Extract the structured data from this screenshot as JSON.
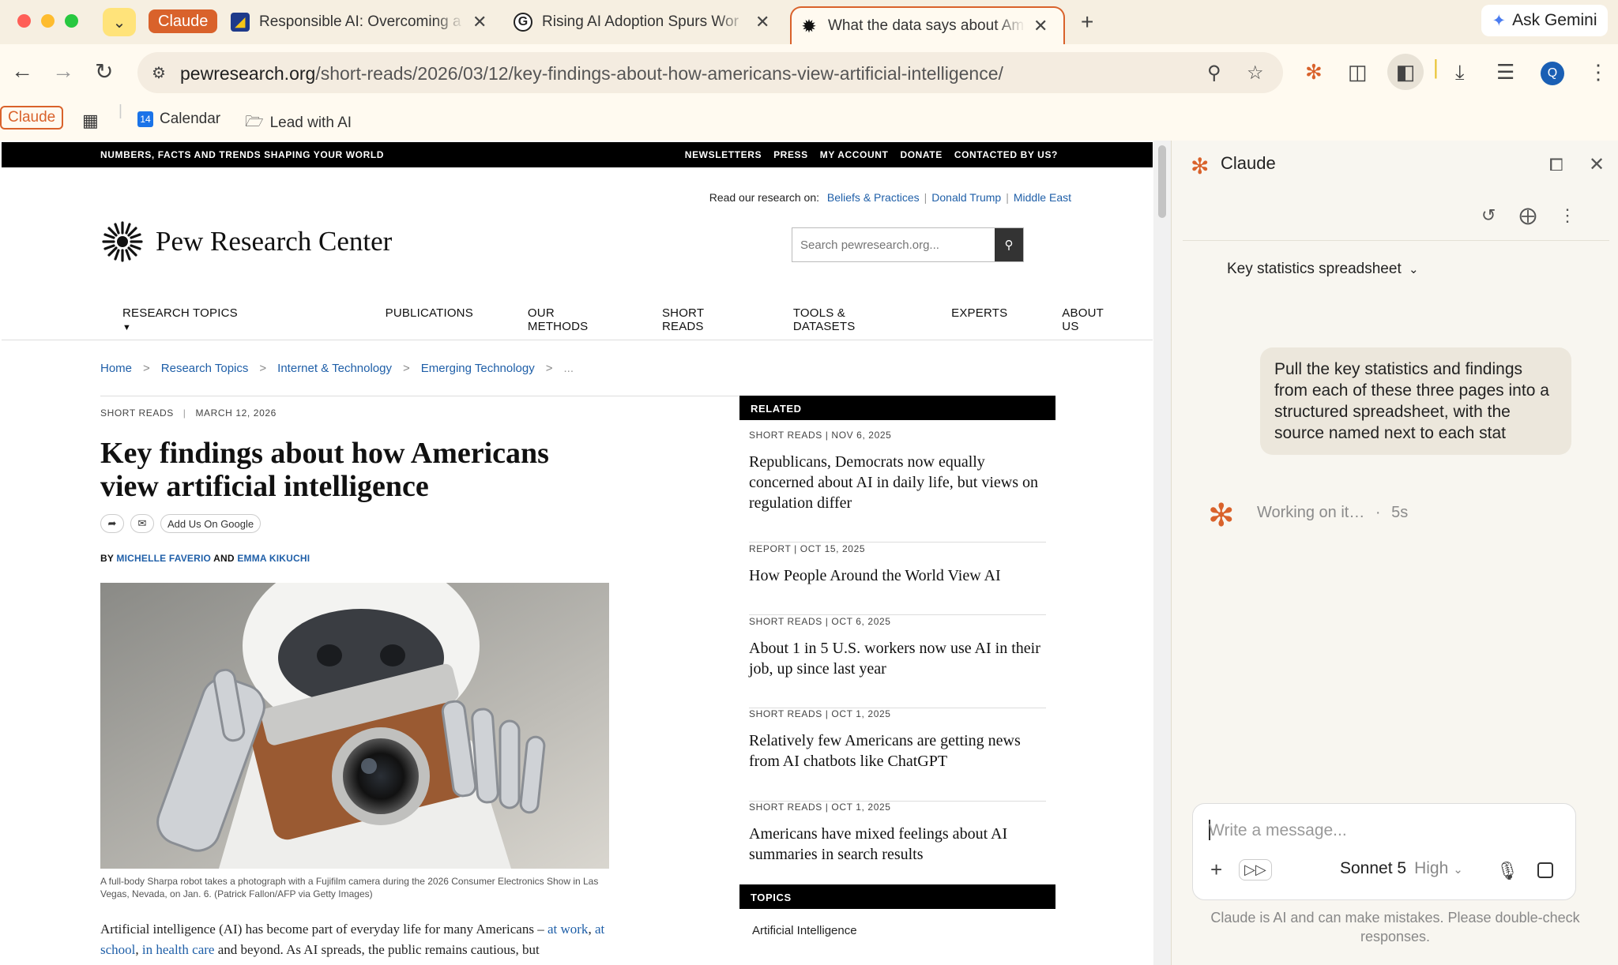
{
  "browser": {
    "tab_group_label": "Claude",
    "tabs": [
      {
        "title": "Responsible AI: Overcoming a",
        "icon": "responsible-ai-favicon"
      },
      {
        "title": "Rising AI Adoption Spurs Wor",
        "icon": "g-favicon"
      },
      {
        "title": "What the data says about Am",
        "icon": "pew-favicon",
        "active": true
      }
    ],
    "ask_gemini": "Ask Gemini",
    "url_host": "pewresearch.org",
    "url_path": "/short-reads/2026/03/12/key-findings-about-how-americans-view-artificial-intelligence/",
    "profile_initial": "Q",
    "bookmarks": {
      "claude": "Claude",
      "calendar": "Calendar",
      "calendar_day": "14",
      "lead": "Lead with AI"
    }
  },
  "site": {
    "tagline": "NUMBERS, FACTS AND TRENDS SHAPING YOUR WORLD",
    "top_links": [
      "NEWSLETTERS",
      "PRESS",
      "MY ACCOUNT",
      "DONATE",
      "CONTACTED BY US?"
    ],
    "read_on_label": "Read our research on:",
    "read_on_links": [
      "Beliefs & Practices",
      "Donald Trump",
      "Middle East"
    ],
    "logo_name": "Pew Research Center",
    "search_placeholder": "Search pewresearch.org...",
    "nav": [
      "RESEARCH TOPICS",
      "PUBLICATIONS",
      "OUR METHODS",
      "SHORT READS",
      "TOOLS & DATASETS",
      "EXPERTS",
      "ABOUT US"
    ],
    "breadcrumbs": [
      "Home",
      "Research Topics",
      "Internet & Technology",
      "Emerging Technology",
      "..."
    ]
  },
  "article": {
    "kicker": "SHORT READS",
    "date": "MARCH 12, 2026",
    "headline": "Key findings about how Americans view artificial intelligence",
    "add_google": "Add Us On Google",
    "by": "BY",
    "author1": "MICHELLE FAVERIO",
    "and": "AND",
    "author2": "EMMA KIKUCHI",
    "caption": "A full-body Sharpa robot takes a photograph with a Fujifilm camera during the 2026 Consumer Electronics Show in Las Vegas, Nevada, on Jan. 6. (Patrick Fallon/AFP via Getty Images)",
    "body_start": "Artificial intelligence (AI) has become part of everyday life for many Americans – ",
    "body_link1": "at work",
    "body_comma": ",",
    "body_link2": "at school",
    "body_link3": "in health care",
    "body_end": " and beyond. As AI spreads, the public remains cautious, but"
  },
  "related": {
    "heading": "RELATED",
    "items": [
      {
        "meta": "SHORT READS | NOV 6, 2025",
        "title": "Republicans, Democrats now equally concerned about AI in daily life, but views on regulation differ"
      },
      {
        "meta": "REPORT | OCT 15, 2025",
        "title": "How People Around the World View AI"
      },
      {
        "meta": "SHORT READS | OCT 6, 2025",
        "title": "About 1 in 5 U.S. workers now use AI in their job, up since last year"
      },
      {
        "meta": "SHORT READS | OCT 1, 2025",
        "title": "Relatively few Americans are getting news from AI chatbots like ChatGPT"
      },
      {
        "meta": "SHORT READS | OCT 1, 2025",
        "title": "Americans have mixed feelings about AI summaries in search results"
      }
    ],
    "topics_heading": "TOPICS",
    "topic": "Artificial Intelligence"
  },
  "claude": {
    "title": "Claude",
    "chat_title": "Key statistics spreadsheet",
    "user_message": "Pull the key statistics and findings from each of these three pages into a structured spreadsheet, with the source named next to each stat",
    "status": "Working on it…",
    "elapsed": "5s",
    "placeholder": "Write a message...",
    "model": "Sonnet 5",
    "effort": "High",
    "disclaimer": "Claude is AI and can make mistakes. Please double-check responses."
  },
  "colors": {
    "accent": "#d9622b",
    "link": "#1f5fa8",
    "chrome_bg": "#f6efe1"
  }
}
